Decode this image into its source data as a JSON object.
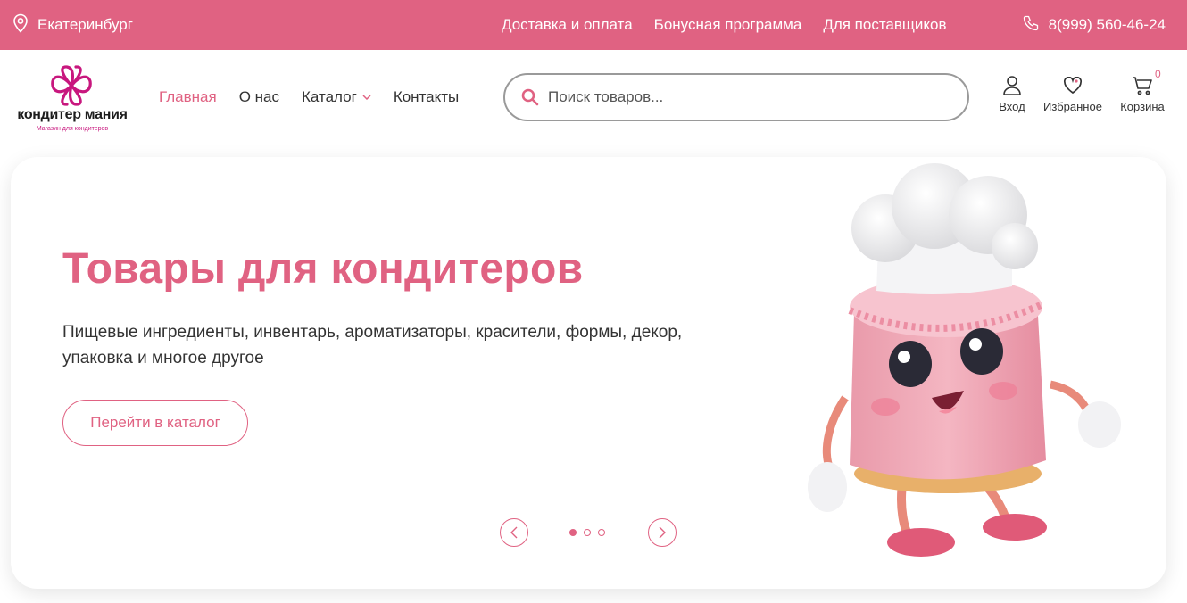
{
  "topbar": {
    "city": "Екатеринбург",
    "links": [
      "Доставка и оплата",
      "Бонусная программа",
      "Для поставщиков"
    ],
    "phone": "8(999) 560-46-24"
  },
  "logo": {
    "brand": "кондитер мания",
    "tagline": "Магазин для кондитеров"
  },
  "nav": {
    "items": [
      "Главная",
      "О нас",
      "Каталог",
      "Контакты"
    ],
    "active": "Главная"
  },
  "search": {
    "placeholder": "Поиск товаров..."
  },
  "actions": {
    "login": "Вход",
    "favorites": "Избранное",
    "cart": "Корзина",
    "cart_count": "0"
  },
  "hero": {
    "title": "Товары для кондитеров",
    "subtitle": "Пищевые ингредиенты, инвентарь, ароматизаторы, красители, формы, декор, упаковка и многое другое",
    "cta": "Перейти в каталог",
    "slides_total": 3,
    "slide_active": 1
  },
  "colors": {
    "accent": "#e06282",
    "logo_accent": "#c8177e"
  },
  "icons": [
    "location-pin-icon",
    "phone-icon",
    "search-icon",
    "user-icon",
    "heart-icon",
    "cart-icon",
    "chevron-down-icon",
    "chevron-left-icon",
    "chevron-right-icon"
  ]
}
